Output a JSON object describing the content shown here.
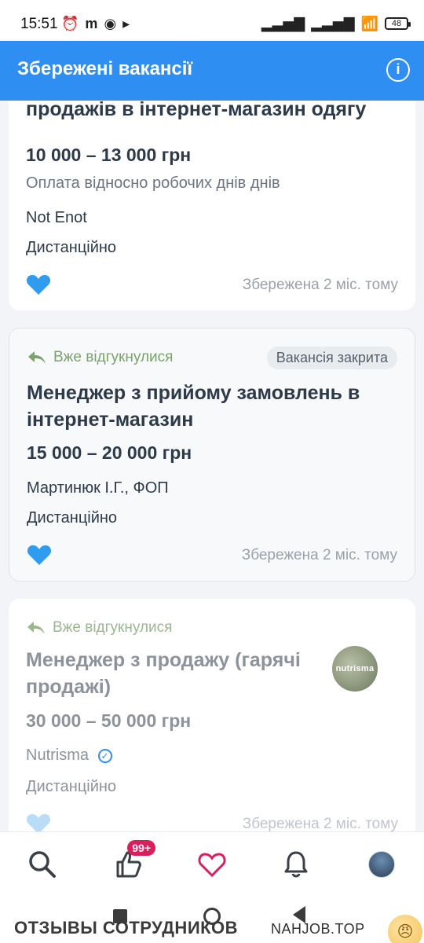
{
  "status_bar": {
    "time": "15:51",
    "left_icons": [
      "alarm-icon",
      "m-icon",
      "chrome-icon",
      "play-icon"
    ],
    "battery_level": "48"
  },
  "app_bar": {
    "title": "Збережені вакансії",
    "info_icon": "info-icon"
  },
  "cards": [
    {
      "title": "Менеджер по роботі з клієнтами, з продажів в інтернет-магазин одягу",
      "salary": "10 000 – 13 000 грн",
      "note": "Оплата відносно робочих днів днів",
      "company": "Not Enot",
      "location": "Дистанційно",
      "saved_time": "Збережена 2 міс. тому",
      "heart_icon": "heart-icon",
      "heart_color": "#2f9cf0"
    },
    {
      "reply_badge": "Вже відгукнулися",
      "closed_label": "Вакансія закрита",
      "title": "Менеджер з прийому замовлень в інтернет-магазин",
      "salary": "15 000 – 20 000 грн",
      "company": "Мартинюк І.Г., ФОП",
      "location": "Дистанційно",
      "saved_time": "Збережена 2 міс. тому",
      "heart_icon": "heart-icon",
      "heart_color": "#2f9cf0"
    },
    {
      "reply_badge": "Вже відгукнулися",
      "title": "Менеджер з продажу (гарячі продажі)",
      "salary": "30 000 – 50 000 грн",
      "company": "Nutrisma",
      "location": "Дистанційно",
      "saved_time": "Збережена 2 міс. тому",
      "logo_text": "nutrisma",
      "heart_icon": "heart-icon",
      "heart_color": "#b9dcf7"
    }
  ],
  "bottom_nav": {
    "items": [
      {
        "name": "search-icon"
      },
      {
        "name": "thumbs-up-icon",
        "badge": "99+"
      },
      {
        "name": "heart-outline-icon"
      },
      {
        "name": "bell-icon"
      },
      {
        "name": "profile-avatar"
      }
    ]
  },
  "system_nav": {
    "watermark_left": "ОТЗЫВЫ СОТРУДНИКОВ",
    "watermark_right": "NAHJOB.TOP"
  },
  "colors": {
    "accent": "#2f8ef2",
    "badge": "#d91f5c",
    "reply": "#7aa36a"
  }
}
